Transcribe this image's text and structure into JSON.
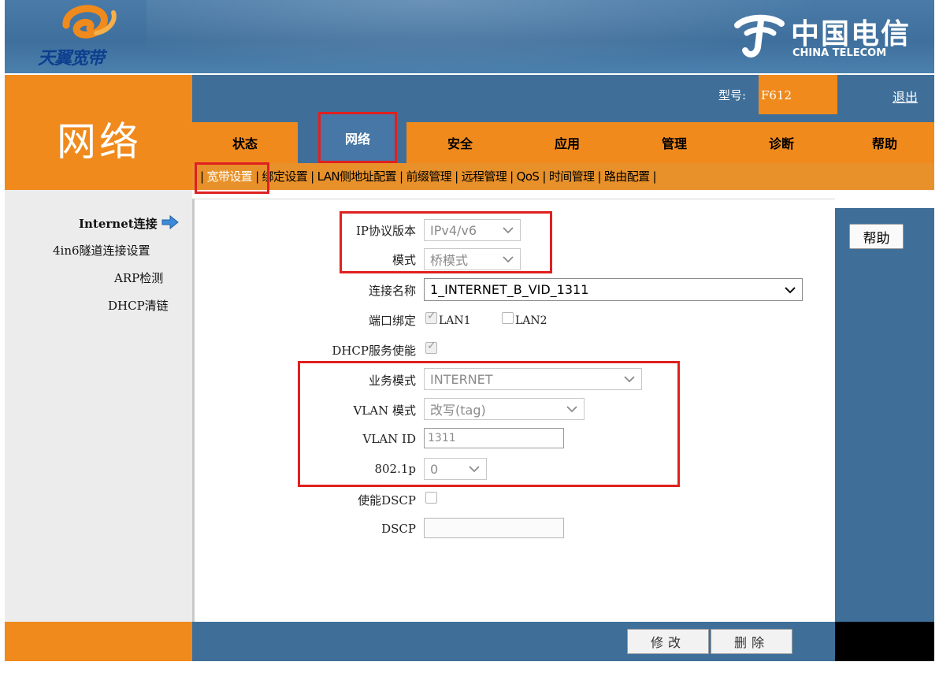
{
  "header": {
    "brand_logo_text": "天翼宽带",
    "operator_name": "中国电信",
    "operator_name_en": "CHINA TELECOM"
  },
  "section_title": "网络",
  "model": {
    "label": "型号:",
    "value": "F612"
  },
  "logout_label": "退出",
  "tabs": [
    {
      "label": "状态"
    },
    {
      "label": "网络",
      "active": true
    },
    {
      "label": "安全"
    },
    {
      "label": "应用"
    },
    {
      "label": "管理"
    },
    {
      "label": "诊断"
    },
    {
      "label": "帮助"
    }
  ],
  "subnav": [
    {
      "label": "宽带设置",
      "active": true
    },
    {
      "label": "绑定设置"
    },
    {
      "label": "LAN侧地址配置"
    },
    {
      "label": "前缀管理"
    },
    {
      "label": "远程管理"
    },
    {
      "label": "QoS"
    },
    {
      "label": "时间管理"
    },
    {
      "label": "路由配置"
    }
  ],
  "left_menu": [
    {
      "label": "Internet连接",
      "active": true
    },
    {
      "label": "4in6隧道连接设置"
    },
    {
      "label": "ARP检测"
    },
    {
      "label": "DHCP清链"
    }
  ],
  "help_button": "帮助",
  "form": {
    "ip_version": {
      "label": "IP协议版本",
      "value": "IPv4/v6"
    },
    "mode": {
      "label": "模式",
      "value": "桥模式"
    },
    "connection_name": {
      "label": "连接名称",
      "value": "1_INTERNET_B_VID_1311"
    },
    "port_binding": {
      "label": "端口绑定",
      "lan1": "LAN1",
      "lan1_checked": true,
      "lan2": "LAN2",
      "lan2_checked": false
    },
    "dhcp_service": {
      "label": "DHCP服务使能",
      "checked": true
    },
    "service_mode": {
      "label": "业务模式",
      "value": "INTERNET"
    },
    "vlan_mode": {
      "label": "VLAN 模式",
      "value": "改写(tag)"
    },
    "vlan_id": {
      "label": "VLAN ID",
      "value": "1311"
    },
    "p8021": {
      "label": "802.1p",
      "value": "0"
    },
    "enable_dscp": {
      "label": "使能DSCP",
      "checked": false
    },
    "dscp": {
      "label": "DSCP",
      "value": ""
    }
  },
  "footer_buttons": {
    "modify": "修改",
    "delete": "删除"
  },
  "colors": {
    "orange": "#f08a1c",
    "blue": "#3f6f99",
    "highlight": "#e02020"
  }
}
